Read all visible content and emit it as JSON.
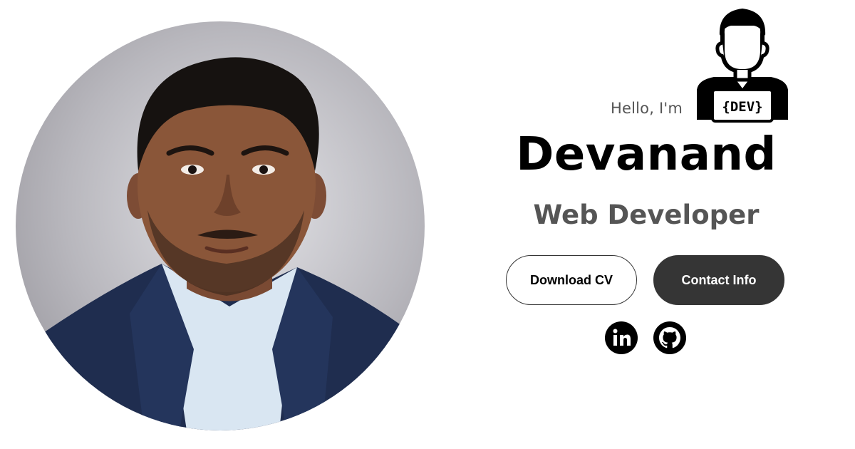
{
  "hero": {
    "greeting": "Hello, I'm",
    "name": "Devanand",
    "role": "Web Developer",
    "logo_text": "{DEV}",
    "buttons": {
      "download_cv": "Download CV",
      "contact_info": "Contact Info"
    },
    "social": [
      {
        "icon": "linkedin-icon"
      },
      {
        "icon": "github-icon"
      }
    ]
  },
  "colors": {
    "primary_text": "#000000",
    "secondary_text": "#555555",
    "button_dark": "#353535",
    "background": "#ffffff"
  }
}
